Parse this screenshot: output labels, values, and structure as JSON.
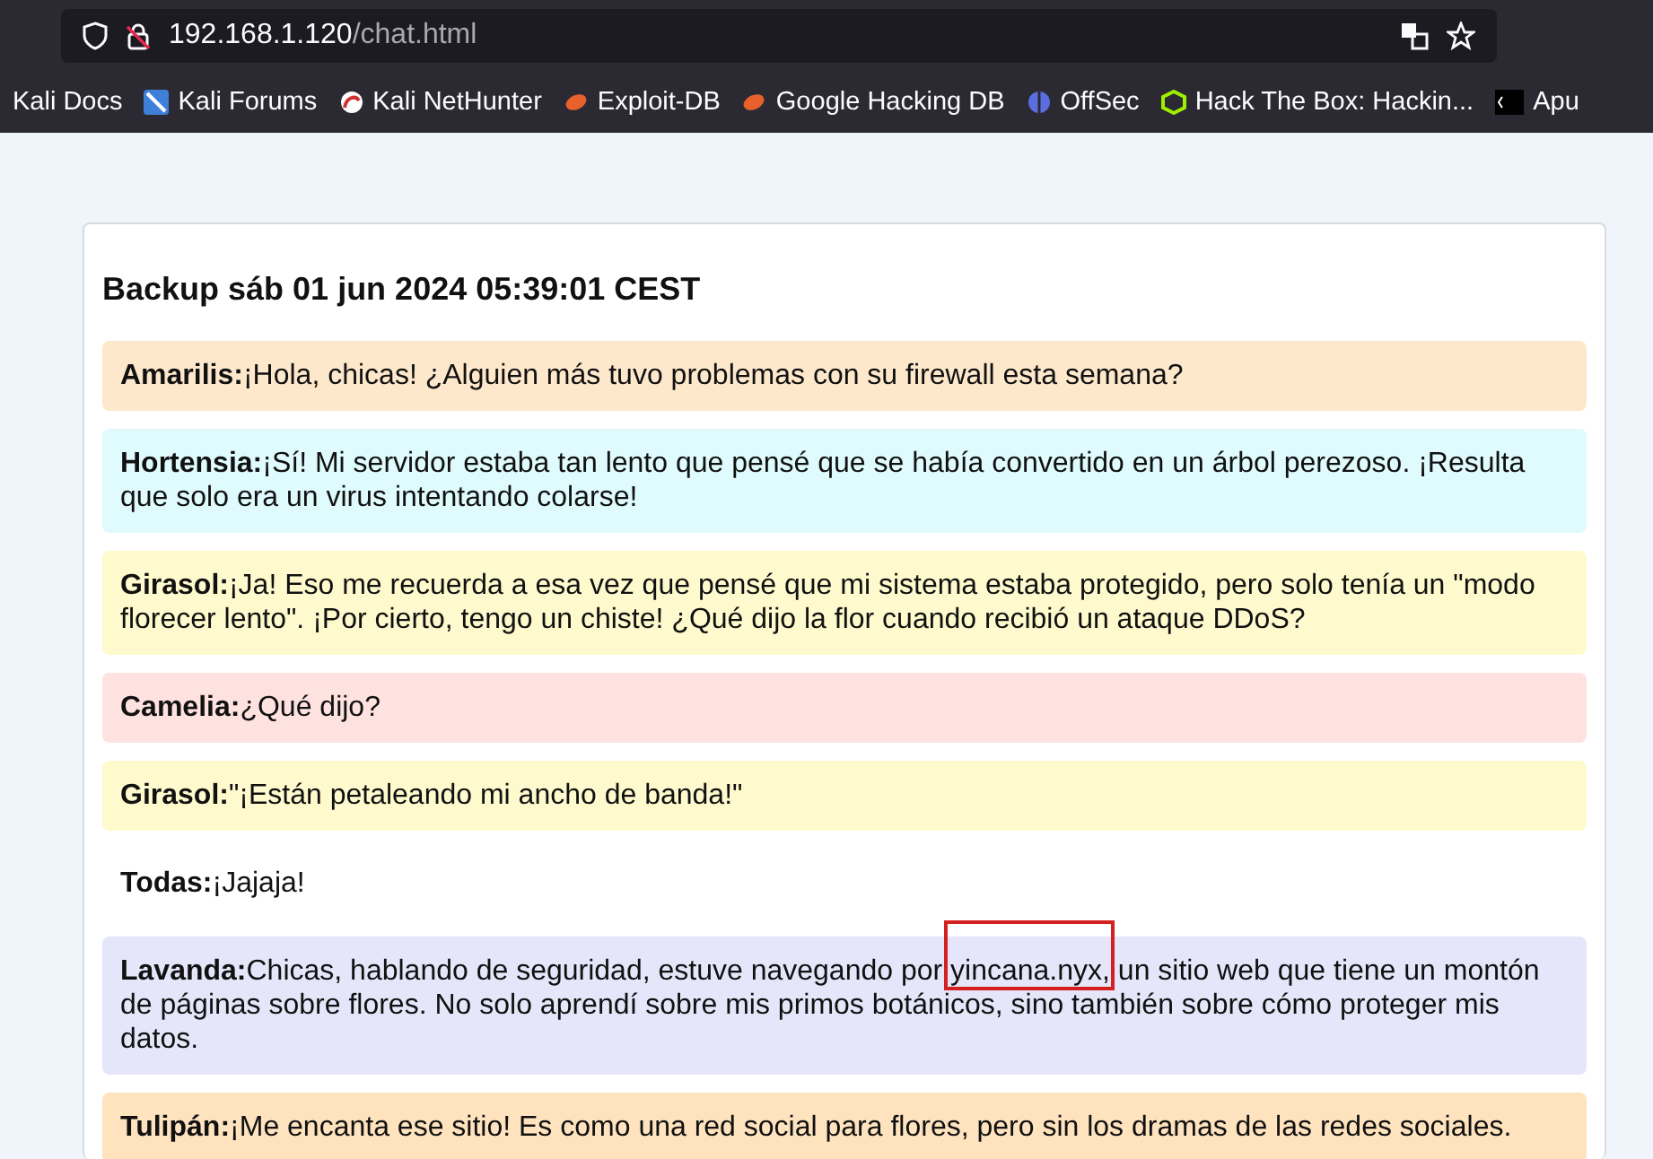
{
  "address_bar": {
    "host": "192.168.1.120",
    "path": "/chat.html"
  },
  "bookmarks": [
    {
      "label": "Kali Docs",
      "kind": "kali"
    },
    {
      "label": "Kali Forums",
      "kind": "forum"
    },
    {
      "label": "Kali NetHunter",
      "kind": "nethunter"
    },
    {
      "label": "Exploit-DB",
      "kind": "exploit"
    },
    {
      "label": "Google Hacking DB",
      "kind": "exploit"
    },
    {
      "label": "OffSec",
      "kind": "offsec"
    },
    {
      "label": "Hack The Box: Hackin...",
      "kind": "htb"
    },
    {
      "label": "Apu",
      "kind": "apu"
    }
  ],
  "chat": {
    "title": "Backup sáb 01 jun 2024 05:39:01 CEST",
    "messages": [
      {
        "author": "Amarilis:",
        "text": "¡Hola, chicas! ¿Alguien más tuvo problemas con su firewall esta semana?",
        "color": "#fde8cc"
      },
      {
        "author": "Hortensia:",
        "text": "¡Sí! Mi servidor estaba tan lento que pensé que se había convertido en un árbol perezoso. ¡Resulta que solo era un virus intentando colarse!",
        "color": "#dffbfd"
      },
      {
        "author": "Girasol:",
        "text": "¡Ja! Eso me recuerda a esa vez que pensé que mi sistema estaba protegido, pero solo tenía un \"modo florecer lento\". ¡Por cierto, tengo un chiste! ¿Qué dijo la flor cuando recibió un ataque DDoS?",
        "color": "#fefacd"
      },
      {
        "author": "Camelia:",
        "text": "¿Qué dijo?",
        "color": "#fde2e0"
      },
      {
        "author": "Girasol:",
        "text": "\"¡Están petaleando mi ancho de banda!\"",
        "color": "#fefacd"
      },
      {
        "author": "Todas:",
        "text": "¡Jajaja!",
        "color": "#ffffff"
      },
      {
        "author": "Lavanda:",
        "text": "Chicas, hablando de seguridad, estuve navegando por yincana.nyx, un sitio web que tiene un montón de páginas sobre flores. No solo aprendí sobre mis primos botánicos, sino también sobre cómo proteger mis datos.",
        "color": "#e6e6fa",
        "highlighted": true
      },
      {
        "author": "Tulipán:",
        "text": "¡Me encanta ese sitio! Es como una red social para flores, pero sin los dramas de las redes sociales.",
        "color": "#fee3be"
      }
    ]
  }
}
